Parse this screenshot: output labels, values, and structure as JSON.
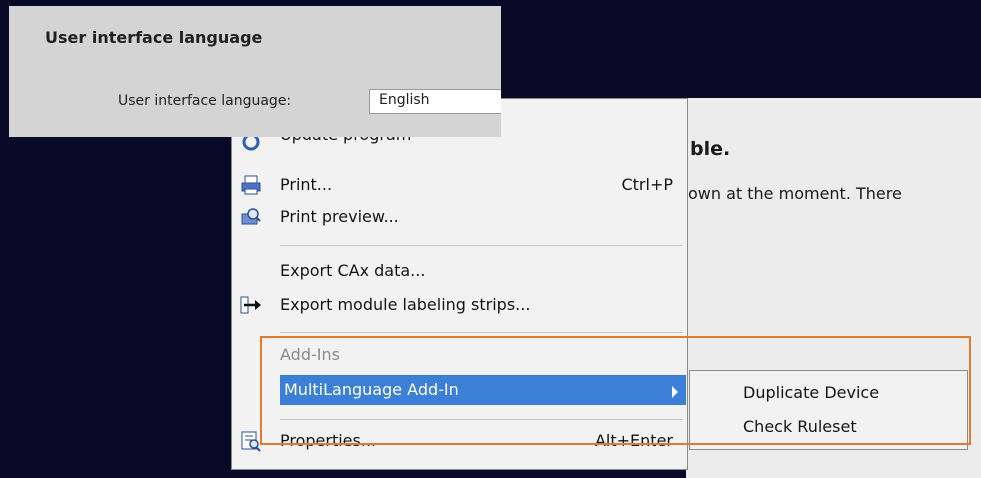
{
  "background_page": {
    "heading_fragment": "ble.",
    "text_fragment": "own at the moment. There"
  },
  "settings": {
    "section_title": "User interface language",
    "language_label": "User interface language:",
    "language_value": "English"
  },
  "context_menu": {
    "partial_item": "Update program",
    "items": [
      {
        "label": "Print...",
        "shortcut": "Ctrl+P",
        "icon": "print-icon"
      },
      {
        "label": "Print preview...",
        "shortcut": "",
        "icon": "print-preview-icon"
      },
      {
        "label": "Export CAx data...",
        "shortcut": "",
        "icon": ""
      },
      {
        "label": "Export module labeling strips...",
        "shortcut": "",
        "icon": "export-arrow-icon"
      },
      {
        "label": "Add-Ins",
        "shortcut": "",
        "icon": "",
        "disabled": true
      },
      {
        "label": "MultiLanguage Add-In",
        "shortcut": "",
        "icon": "",
        "submenu": true
      },
      {
        "label": "Properties...",
        "shortcut": "Alt+Enter",
        "icon": "properties-icon"
      }
    ]
  },
  "submenu": {
    "items": [
      "Duplicate Device",
      "Check Ruleset"
    ]
  },
  "colors": {
    "highlight": "#3c7fd6",
    "callout_frame": "#e07a2e",
    "desktop": "#0a0a28"
  }
}
